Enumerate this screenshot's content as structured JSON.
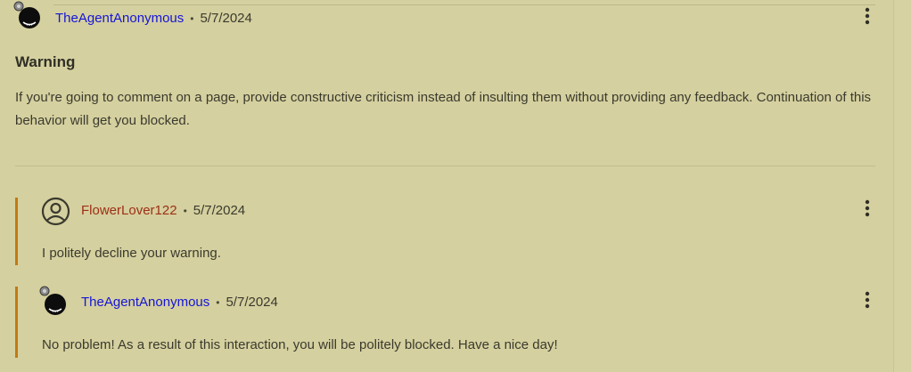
{
  "main_comment": {
    "author": "TheAgentAnonymous",
    "separator": "•",
    "date": "5/7/2024",
    "title": "Warning",
    "body": "If you're going to comment on a page, provide constructive criticism instead of insulting them without providing any feedback. Continuation of this behavior will get you blocked."
  },
  "replies": [
    {
      "author": "FlowerLover122",
      "separator": "•",
      "date": "5/7/2024",
      "body": "I politely decline your warning."
    },
    {
      "author": "TheAgentAnonymous",
      "separator": "•",
      "date": "5/7/2024",
      "body": "No problem! As a result of this interaction, you will be politely blocked. Have a nice day!"
    }
  ],
  "icons": {
    "avatar_main": "bomb-avatar-icon",
    "avatar_default": "user-circle-icon",
    "menu": "more-vertical-icon"
  },
  "colors": {
    "background": "#d5d09f",
    "author_link": "#1515d6",
    "author_alt": "#9c2f17",
    "reply_bar": "#c27a14"
  }
}
